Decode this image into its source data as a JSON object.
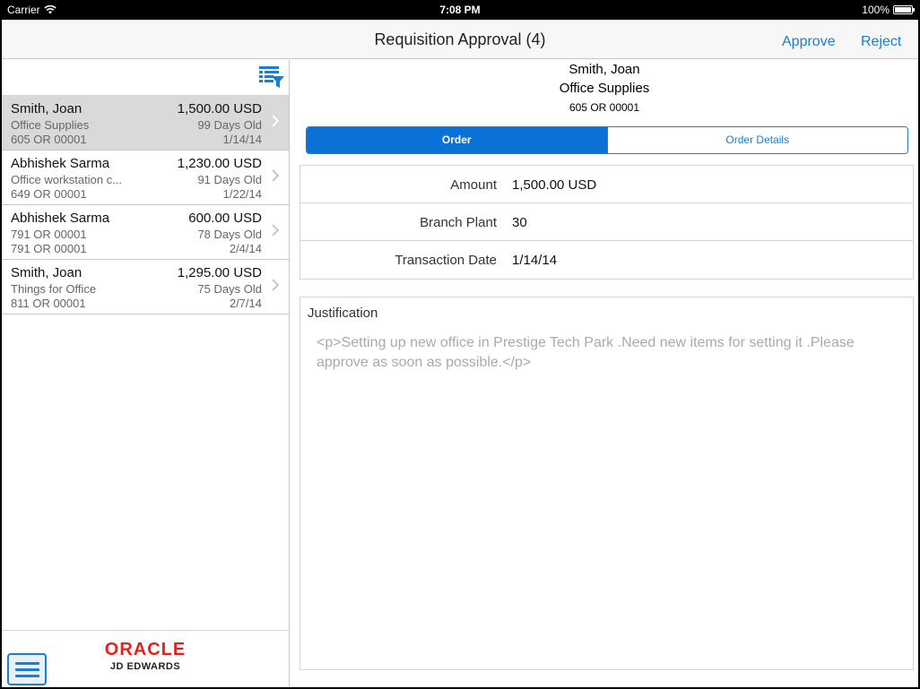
{
  "status_bar": {
    "carrier": "Carrier",
    "time": "7:08 PM",
    "battery": "100%"
  },
  "nav": {
    "title": "Requisition Approval (4)",
    "approve_label": "Approve",
    "reject_label": "Reject"
  },
  "list": {
    "items": [
      {
        "name": "Smith, Joan",
        "amount": "1,500.00 USD",
        "description": "Office Supplies",
        "age": "99 Days Old",
        "order": "605 OR 00001",
        "date": "1/14/14",
        "selected": true
      },
      {
        "name": "Abhishek Sarma",
        "amount": "1,230.00 USD",
        "description": "Office workstation c...",
        "age": "91 Days Old",
        "order": "649 OR 00001",
        "date": "1/22/14",
        "selected": false
      },
      {
        "name": "Abhishek Sarma",
        "amount": "600.00 USD",
        "description": "791 OR 00001",
        "age": "78 Days Old",
        "order": "791 OR 00001",
        "date": "2/4/14",
        "selected": false
      },
      {
        "name": "Smith, Joan",
        "amount": "1,295.00 USD",
        "description": "Things for Office",
        "age": "75 Days Old",
        "order": "811 OR 00001",
        "date": "2/7/14",
        "selected": false
      }
    ]
  },
  "footer": {
    "logo_oracle": "ORACLE",
    "logo_sub": "JD EDWARDS"
  },
  "detail": {
    "name": "Smith, Joan",
    "description": "Office Supplies",
    "order": "605 OR 00001",
    "tabs": [
      {
        "label": "Order",
        "active": true
      },
      {
        "label": "Order Details",
        "active": false
      }
    ],
    "fields": [
      {
        "label": "Amount",
        "value": "1,500.00 USD"
      },
      {
        "label": "Branch Plant",
        "value": "30"
      },
      {
        "label": "Transaction Date",
        "value": "1/14/14"
      }
    ],
    "justification_label": "Justification",
    "justification_text": "<p>Setting up new office in Prestige Tech Park .Need new items for setting it .Please approve as soon as possible.</p>"
  },
  "colors": {
    "accent": "#1a7fd0",
    "active_tab": "#0a72d6",
    "selected_row": "#d9d9d9",
    "oracle_red": "#e2231a"
  }
}
